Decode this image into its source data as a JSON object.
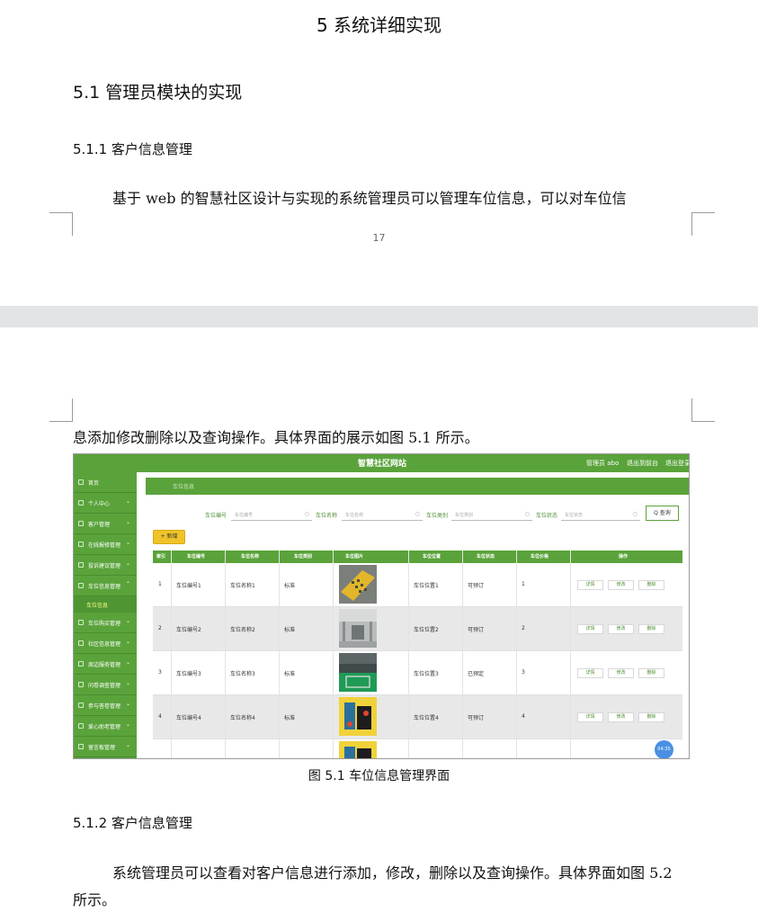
{
  "page1": {
    "chapter_title": "5 系统详细实现",
    "section_title": "5.1  管理员模块的实现",
    "subsection_title": "5.1.1  客户信息管理",
    "paragraph": "基于 web 的智慧社区设计与实现的系统管理员可以管理车位信息，可以对车位信",
    "page_number": "17"
  },
  "page2": {
    "paragraph_cont": "息添加修改删除以及查询操作。具体界面的展示如图 5.1 所示。",
    "figure_caption": "图 5.1  车位信息管理界面",
    "subsection_title": "5.1.2  客户信息管理",
    "paragraph2": "系统管理员可以查看对客户信息进行添加，修改，删除以及查询操作。具体界面如图 5.2 所示。"
  },
  "screenshot": {
    "site_title": "智慧社区网站",
    "top_links": [
      "管理员 abo",
      "退出到前台",
      "退出登录"
    ],
    "breadcrumb": "车位信息",
    "sidebar": [
      {
        "label": "首页",
        "chevron": ""
      },
      {
        "label": "个人中心",
        "chevron": "⌄"
      },
      {
        "label": "客户管理",
        "chevron": "⌄"
      },
      {
        "label": "在线报修管理",
        "chevron": "⌄"
      },
      {
        "label": "投诉建议管理",
        "chevron": "⌄"
      },
      {
        "label": "车位信息管理",
        "chevron": "⌃"
      },
      {
        "label": "车位信息",
        "chevron": ""
      },
      {
        "label": "车位购买管理",
        "chevron": "⌄"
      },
      {
        "label": "社区信息管理",
        "chevron": "⌄"
      },
      {
        "label": "周边服务管理",
        "chevron": "⌄"
      },
      {
        "label": "问卷调查管理",
        "chevron": "⌄"
      },
      {
        "label": "参与答卷管理",
        "chevron": "⌄"
      },
      {
        "label": "爱心助老管理",
        "chevron": "⌄"
      },
      {
        "label": "留言板管理",
        "chevron": "⌄"
      }
    ],
    "filters": [
      {
        "label": "车位编号",
        "placeholder": "车位编号"
      },
      {
        "label": "车位名称",
        "placeholder": "车位名称"
      },
      {
        "label": "车位类别",
        "placeholder": "车位类别"
      },
      {
        "label": "车位状态",
        "placeholder": "车位状态"
      }
    ],
    "search_button": "Q 查询",
    "add_button": "+ 新增",
    "table": {
      "headers": [
        "索引",
        "车位编号",
        "车位名称",
        "车位类别",
        "车位图片",
        "车位位置",
        "车位状态",
        "车位价格",
        "操作"
      ],
      "rows": [
        {
          "index": "1",
          "code": "车位编号1",
          "name": "车位名称1",
          "type": "标准",
          "location": "车位位置1",
          "status": "可预订",
          "price": "1"
        },
        {
          "index": "2",
          "code": "车位编号2",
          "name": "车位名称2",
          "type": "标准",
          "location": "车位位置2",
          "status": "可预订",
          "price": "2"
        },
        {
          "index": "3",
          "code": "车位编号3",
          "name": "车位名称3",
          "type": "标准",
          "location": "车位位置3",
          "status": "已预定",
          "price": "3"
        },
        {
          "index": "4",
          "code": "车位编号4",
          "name": "车位名称4",
          "type": "标准",
          "location": "车位位置4",
          "status": "可预订",
          "price": "4"
        }
      ],
      "actions": [
        "详情",
        "修改",
        "删除"
      ]
    },
    "chat_bubble": "04:35",
    "colors": {
      "primary_green": "#5aa33b",
      "add_yellow": "#f0c328",
      "bubble_blue": "#4a90e2"
    }
  }
}
